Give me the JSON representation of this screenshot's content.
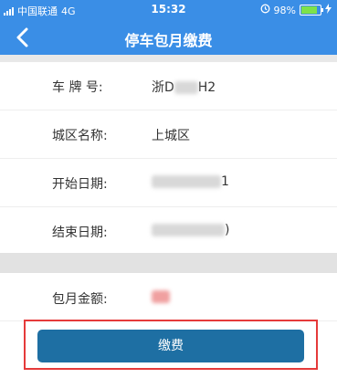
{
  "status_bar": {
    "carrier": "中国联通",
    "network": "4G",
    "time": "15:32",
    "battery": "98%",
    "icons": [
      "signal-icon",
      "alarm-icon",
      "battery-icon",
      "charging-icon"
    ]
  },
  "header": {
    "title": "停车包月缴费",
    "back_icon": "chevron-left-icon"
  },
  "form": {
    "rows": [
      {
        "label": "车 牌 号:",
        "value_prefix": "浙D",
        "value_suffix": "H2"
      },
      {
        "label": "城区名称:",
        "value": "上城区"
      },
      {
        "label": "开始日期:",
        "value_suffix": "1"
      },
      {
        "label": "结束日期:",
        "value_suffix": ")"
      }
    ],
    "amount": {
      "label": "包月金额:"
    }
  },
  "pay_button": {
    "label": "缴费"
  },
  "colors": {
    "header": "#3a8ee6",
    "button": "#1e6fa3",
    "highlight": "#e53a3a"
  }
}
